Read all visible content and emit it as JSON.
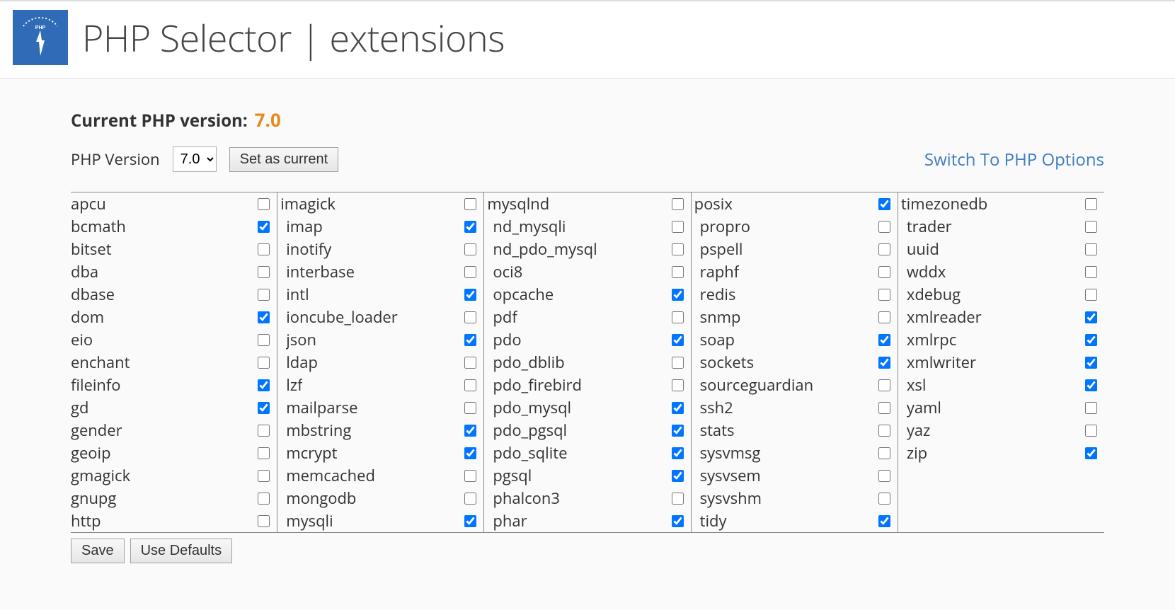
{
  "header": {
    "title": "PHP Selector | extensions"
  },
  "version": {
    "label": "Current PHP version:",
    "value": "7.0"
  },
  "selector": {
    "label": "PHP Version",
    "selected": "7.0",
    "button": "Set as current"
  },
  "options_link": "Switch To PHP Options",
  "footer": {
    "save": "Save",
    "defaults": "Use Defaults"
  },
  "extensions": {
    "columns": [
      [
        {
          "name": "apcu",
          "checked": false
        },
        {
          "name": "bcmath",
          "checked": true
        },
        {
          "name": "bitset",
          "checked": false
        },
        {
          "name": "dba",
          "checked": false
        },
        {
          "name": "dbase",
          "checked": false
        },
        {
          "name": "dom",
          "checked": true
        },
        {
          "name": "eio",
          "checked": false
        },
        {
          "name": "enchant",
          "checked": false
        },
        {
          "name": "fileinfo",
          "checked": true
        },
        {
          "name": "gd",
          "checked": true
        },
        {
          "name": "gender",
          "checked": false
        },
        {
          "name": "geoip",
          "checked": false
        },
        {
          "name": "gmagick",
          "checked": false
        },
        {
          "name": "gnupg",
          "checked": false
        },
        {
          "name": "http",
          "checked": false
        }
      ],
      [
        {
          "name": "imagick",
          "checked": false
        },
        {
          "name": "imap",
          "checked": true
        },
        {
          "name": "inotify",
          "checked": false
        },
        {
          "name": "interbase",
          "checked": false
        },
        {
          "name": "intl",
          "checked": true
        },
        {
          "name": "ioncube_loader",
          "checked": false
        },
        {
          "name": "json",
          "checked": true
        },
        {
          "name": "ldap",
          "checked": false
        },
        {
          "name": "lzf",
          "checked": false
        },
        {
          "name": "mailparse",
          "checked": false
        },
        {
          "name": "mbstring",
          "checked": true
        },
        {
          "name": "mcrypt",
          "checked": true
        },
        {
          "name": "memcached",
          "checked": false
        },
        {
          "name": "mongodb",
          "checked": false
        },
        {
          "name": "mysqli",
          "checked": true
        }
      ],
      [
        {
          "name": "mysqlnd",
          "checked": false
        },
        {
          "name": "nd_mysqli",
          "checked": false
        },
        {
          "name": "nd_pdo_mysql",
          "checked": false
        },
        {
          "name": "oci8",
          "checked": false
        },
        {
          "name": "opcache",
          "checked": true
        },
        {
          "name": "pdf",
          "checked": false
        },
        {
          "name": "pdo",
          "checked": true
        },
        {
          "name": "pdo_dblib",
          "checked": false
        },
        {
          "name": "pdo_firebird",
          "checked": false
        },
        {
          "name": "pdo_mysql",
          "checked": true
        },
        {
          "name": "pdo_pgsql",
          "checked": true
        },
        {
          "name": "pdo_sqlite",
          "checked": true
        },
        {
          "name": "pgsql",
          "checked": true
        },
        {
          "name": "phalcon3",
          "checked": false
        },
        {
          "name": "phar",
          "checked": true
        }
      ],
      [
        {
          "name": "posix",
          "checked": true
        },
        {
          "name": "propro",
          "checked": false
        },
        {
          "name": "pspell",
          "checked": false
        },
        {
          "name": "raphf",
          "checked": false
        },
        {
          "name": "redis",
          "checked": false
        },
        {
          "name": "snmp",
          "checked": false
        },
        {
          "name": "soap",
          "checked": true
        },
        {
          "name": "sockets",
          "checked": true
        },
        {
          "name": "sourceguardian",
          "checked": false
        },
        {
          "name": "ssh2",
          "checked": false
        },
        {
          "name": "stats",
          "checked": false
        },
        {
          "name": "sysvmsg",
          "checked": false
        },
        {
          "name": "sysvsem",
          "checked": false
        },
        {
          "name": "sysvshm",
          "checked": false
        },
        {
          "name": "tidy",
          "checked": true
        }
      ],
      [
        {
          "name": "timezonedb",
          "checked": false
        },
        {
          "name": "trader",
          "checked": false
        },
        {
          "name": "uuid",
          "checked": false
        },
        {
          "name": "wddx",
          "checked": false
        },
        {
          "name": "xdebug",
          "checked": false
        },
        {
          "name": "xmlreader",
          "checked": true
        },
        {
          "name": "xmlrpc",
          "checked": true
        },
        {
          "name": "xmlwriter",
          "checked": true
        },
        {
          "name": "xsl",
          "checked": true
        },
        {
          "name": "yaml",
          "checked": false
        },
        {
          "name": "yaz",
          "checked": false
        },
        {
          "name": "zip",
          "checked": true
        }
      ]
    ]
  }
}
